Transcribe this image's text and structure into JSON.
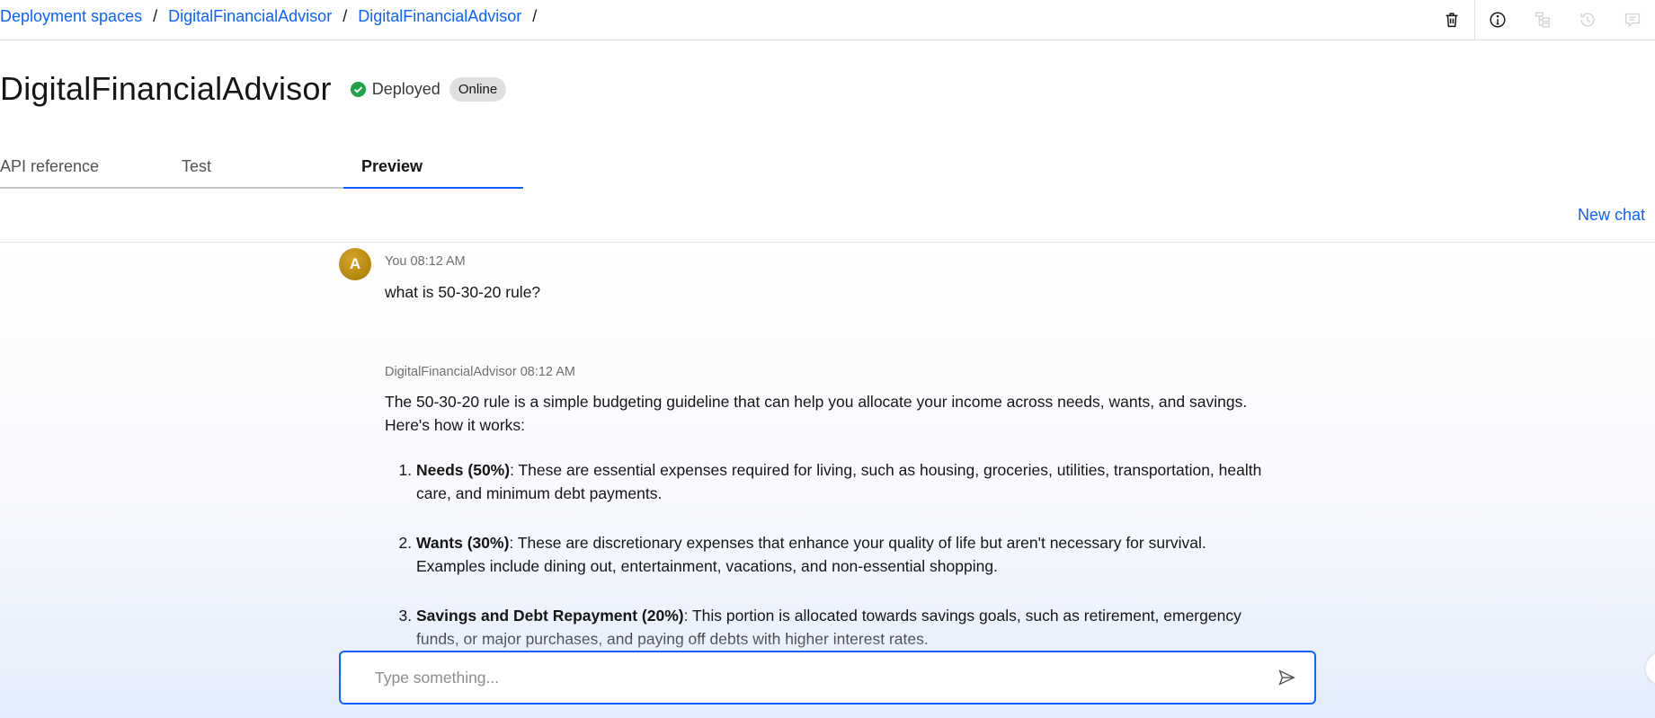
{
  "breadcrumb": [
    {
      "label": "Deployment spaces"
    },
    {
      "label": "DigitalFinancialAdvisor"
    },
    {
      "label": "DigitalFinancialAdvisor"
    }
  ],
  "breadcrumb_separator": "/",
  "toolbar": {
    "icons": [
      "trash-icon",
      "info-icon",
      "hierarchy-icon",
      "history-icon",
      "comment-icon"
    ]
  },
  "header": {
    "title": "DigitalFinancialAdvisor",
    "status": "Deployed",
    "status_color": "#24a148",
    "tag": "Online"
  },
  "tabs": [
    {
      "label": "API reference",
      "active": false
    },
    {
      "label": "Test",
      "active": false
    },
    {
      "label": "Preview",
      "active": true
    }
  ],
  "chat": {
    "new_chat_label": "New chat",
    "user": {
      "avatar_initial": "A",
      "sender": "You",
      "time": "08:12 AM",
      "message": "what is 50-30-20 rule?"
    },
    "assistant": {
      "sender": "DigitalFinancialAdvisor",
      "time": "08:12 AM",
      "intro": "The 50-30-20 rule is a simple budgeting guideline that can help you allocate your income across needs, wants, and savings. Here's how it works:",
      "items": [
        {
          "title": "Needs (50%)",
          "text": ": These are essential expenses required for living, such as housing, groceries, utilities, transportation, health care, and minimum debt payments."
        },
        {
          "title": "Wants (30%)",
          "text": ": These are discretionary expenses that enhance your quality of life but aren't necessary for survival. Examples include dining out, entertainment, vacations, and non-essential shopping."
        },
        {
          "title": "Savings and Debt Repayment (20%)",
          "text": ": This portion is allocated towards savings goals, such as retirement, emergency funds, or major purchases, and paying off debts with higher interest rates."
        }
      ]
    },
    "input": {
      "placeholder": "Type something...",
      "value": ""
    }
  },
  "colors": {
    "accent": "#0f62fe",
    "avatar": "#c0921a"
  }
}
